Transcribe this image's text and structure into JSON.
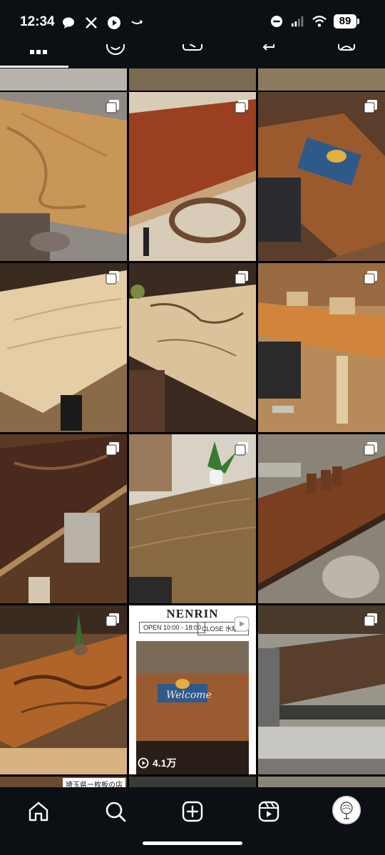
{
  "status_bar": {
    "time": "12:34",
    "battery": "89",
    "left_icons": [
      "chat-bubble-icon",
      "x-logo-icon",
      "play-circle-icon",
      "amazon-smile-icon"
    ],
    "right_icons": [
      "do-not-disturb-icon",
      "signal-icon",
      "wifi-icon",
      "battery-icon"
    ]
  },
  "profile_tabs": [
    "grid-tab",
    "reels-tab",
    "video-tab",
    "tagged-return-tab",
    "saved-tab"
  ],
  "grid": {
    "posts": [
      {
        "kind": "wood-table",
        "multi": true
      },
      {
        "kind": "red-wood-table",
        "multi": true
      },
      {
        "kind": "dining-set",
        "multi": true
      },
      {
        "kind": "ash-table",
        "multi": true
      },
      {
        "kind": "maple-table",
        "multi": true
      },
      {
        "kind": "dining-set-light",
        "multi": true
      },
      {
        "kind": "walnut-table",
        "multi": true
      },
      {
        "kind": "oak-table",
        "multi": true
      },
      {
        "kind": "long-table",
        "multi": true
      },
      {
        "kind": "zebra-table",
        "multi": true
      },
      {
        "kind": "nenrin-reel",
        "multi": false
      },
      {
        "kind": "workshop-slab",
        "multi": true
      }
    ],
    "nenrin": {
      "title": "NENRIN",
      "open_label": "OPEN  10:00 - 18:00",
      "close_label": "CLOSE  水曜日",
      "welcome": "Welcome",
      "views": "4.1万"
    },
    "bottom_label": "埼玉県一枚板の店"
  },
  "bottom_nav": [
    "home-icon",
    "search-icon",
    "create-icon",
    "reels-icon",
    "profile-avatar"
  ],
  "colors": {
    "background": "#000000",
    "bar": "#0c0f14",
    "accent": "#ffffff"
  }
}
